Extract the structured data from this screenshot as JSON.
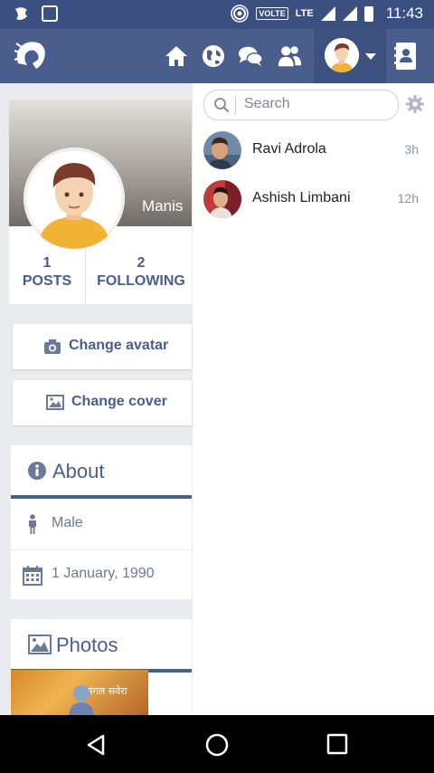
{
  "status_bar": {
    "volte": "VOLTE",
    "network": "LTE",
    "time": "11:43"
  },
  "profile": {
    "name_on_cover": "Manis",
    "stats": [
      {
        "value": "1",
        "label": "POSTS"
      },
      {
        "value": "2",
        "label": "FOLLOWING"
      }
    ],
    "change_avatar_label": "Change avatar",
    "change_cover_label": "Change cover",
    "about": {
      "title": "About",
      "gender": "Male",
      "birthday": "1 January, 1990"
    },
    "photos": {
      "title": "Photos",
      "thumb_text_1": "मंगल सवेरा"
    }
  },
  "chat_panel": {
    "search_placeholder": "Search",
    "contacts": [
      {
        "name": "Ravi Adrola",
        "time": "3h"
      },
      {
        "name": "Ashish Limbani",
        "time": "12h"
      }
    ]
  },
  "colors": {
    "brand": "#4a5e8e",
    "status_bar": "#3b4f81"
  }
}
